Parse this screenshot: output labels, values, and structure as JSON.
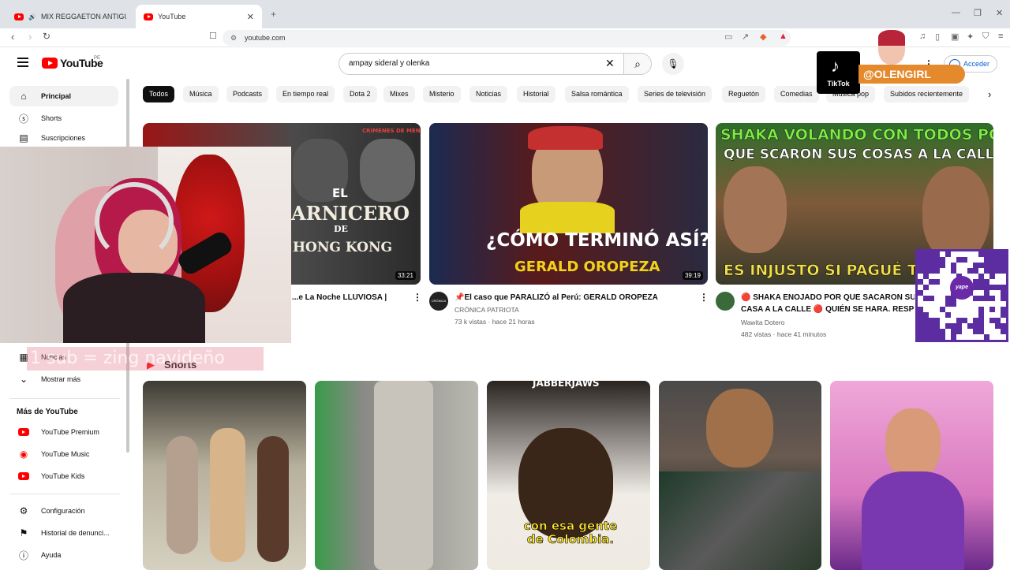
{
  "browser": {
    "tabs": [
      {
        "label": "MIX REGGAETON ANTIGUO🔥 (C",
        "active": false
      },
      {
        "label": "YouTube",
        "active": true
      }
    ],
    "url": "youtube.com"
  },
  "youtube": {
    "logo_text": "YouTube",
    "region": "PE",
    "search_value": "ampay sideral y olenka",
    "signin_label": "Acceder",
    "chips": [
      "Todos",
      "Música",
      "Podcasts",
      "En tiempo real",
      "Dota 2",
      "Mixes",
      "Misterio",
      "Noticias",
      "Historial",
      "Salsa romántica",
      "Series de televisión",
      "Reguetón",
      "Comedias",
      "Música pop",
      "Subidos recientemente"
    ],
    "sidebar": {
      "top": [
        "Principal",
        "Shorts",
        "Suscripciones"
      ],
      "explore": [
        "Noticias",
        "Mostrar más"
      ],
      "more_title": "Más de YouTube",
      "more": [
        "YouTube Premium",
        "YouTube Music",
        "YouTube Kids"
      ],
      "bottom": [
        "Configuración",
        "Historial de denunci...",
        "Ayuda"
      ]
    },
    "videos": [
      {
        "title": "...e La Noche LLUVIOSA |",
        "duration": "33:21",
        "thumb_text_1": "EL",
        "thumb_text_2": "ARNICERO",
        "thumb_text_3": "DE",
        "thumb_text_4": "HONG KONG",
        "thumb_corner": "CRIMENES DE MENTES"
      },
      {
        "title": "📌El caso que PARALIZÓ al Perú: GERALD OROPEZA",
        "channel": "CRÓNICA PATRIOTA",
        "meta": "73 k vistas · hace 21 horas",
        "duration": "39:19",
        "thumb_text_1": "¿CÓMO TERMINÓ ASÍ?",
        "thumb_text_2": "GERALD OROPEZA",
        "avatar_label": "CRÓNICA"
      },
      {
        "title": "🔴 SHAKA ENOJADO POR QUE SACARON SUS",
        "title2": "CASA A LA CALLE 🔴 QUIÉN SE HARA. RESP",
        "channel": "Wawita Dotero",
        "meta": "482 vistas · hace 41 minutos",
        "thumb_text_1": "SHAKA VOLANDO CON TODOS POR",
        "thumb_text_2": "QUE SCARON SUS COSAS A LA CALLE",
        "thumb_text_3": "ES INJUSTO SI PAGUÉ TOD"
      }
    ],
    "shorts_title": "Shorts",
    "shorts": [
      {
        "caption": ""
      },
      {
        "caption": ""
      },
      {
        "caption_top": "JABBERJAWS",
        "caption": "con esa gente de Colombia."
      },
      {
        "caption": ""
      },
      {
        "caption": ""
      }
    ]
  },
  "overlay": {
    "subtitle": "1 sub = zing navideño",
    "tiktok_label": "TikTok",
    "tiktok_handle": "@OLENGIRL",
    "qr_label": "yape"
  },
  "colors": {
    "youtube_red": "#ff0000",
    "chip_active": "#0f0f0f",
    "link_blue": "#065fd4",
    "tiktok_orange": "#e48a2c",
    "yape_purple": "#5c2da0"
  }
}
